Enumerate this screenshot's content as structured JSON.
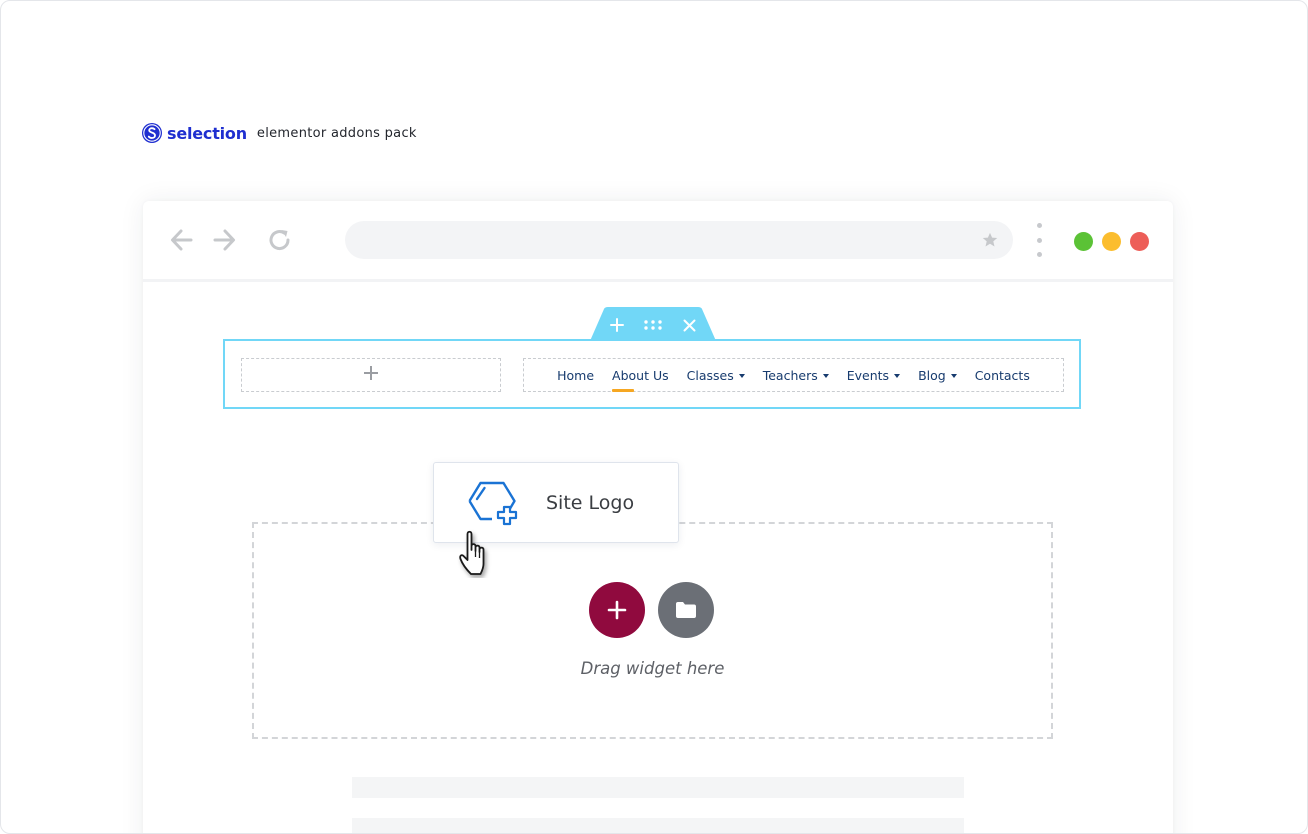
{
  "branding": {
    "name": "selection",
    "tagline": "elementor addons pack"
  },
  "browser": {
    "address": "",
    "window_dots": [
      "#5bc236",
      "#fbbd2e",
      "#ed5e58"
    ]
  },
  "header_section": {
    "tools": [
      "add-icon",
      "drag-handle-icon",
      "close-icon"
    ],
    "left_column": "add-icon",
    "menu": [
      {
        "label": "Home",
        "has_dropdown": false,
        "active": false
      },
      {
        "label": "About Us",
        "has_dropdown": false,
        "active": true
      },
      {
        "label": "Classes",
        "has_dropdown": true,
        "active": false
      },
      {
        "label": "Teachers",
        "has_dropdown": true,
        "active": false
      },
      {
        "label": "Events",
        "has_dropdown": true,
        "active": false
      },
      {
        "label": "Blog",
        "has_dropdown": true,
        "active": false
      },
      {
        "label": "Contacts",
        "has_dropdown": false,
        "active": false
      }
    ]
  },
  "widget": {
    "label": "Site Logo",
    "icon": "hexagon-plus-icon"
  },
  "dropzone": {
    "text": "Drag widget here",
    "add_button_color": "#900a3e",
    "template_button_color": "#6b6f76"
  },
  "colors": {
    "accent_blue": "#71d7f7",
    "menu_text": "#173b6e",
    "active_underline": "#f6a722",
    "brand": "#1f2fd0"
  }
}
